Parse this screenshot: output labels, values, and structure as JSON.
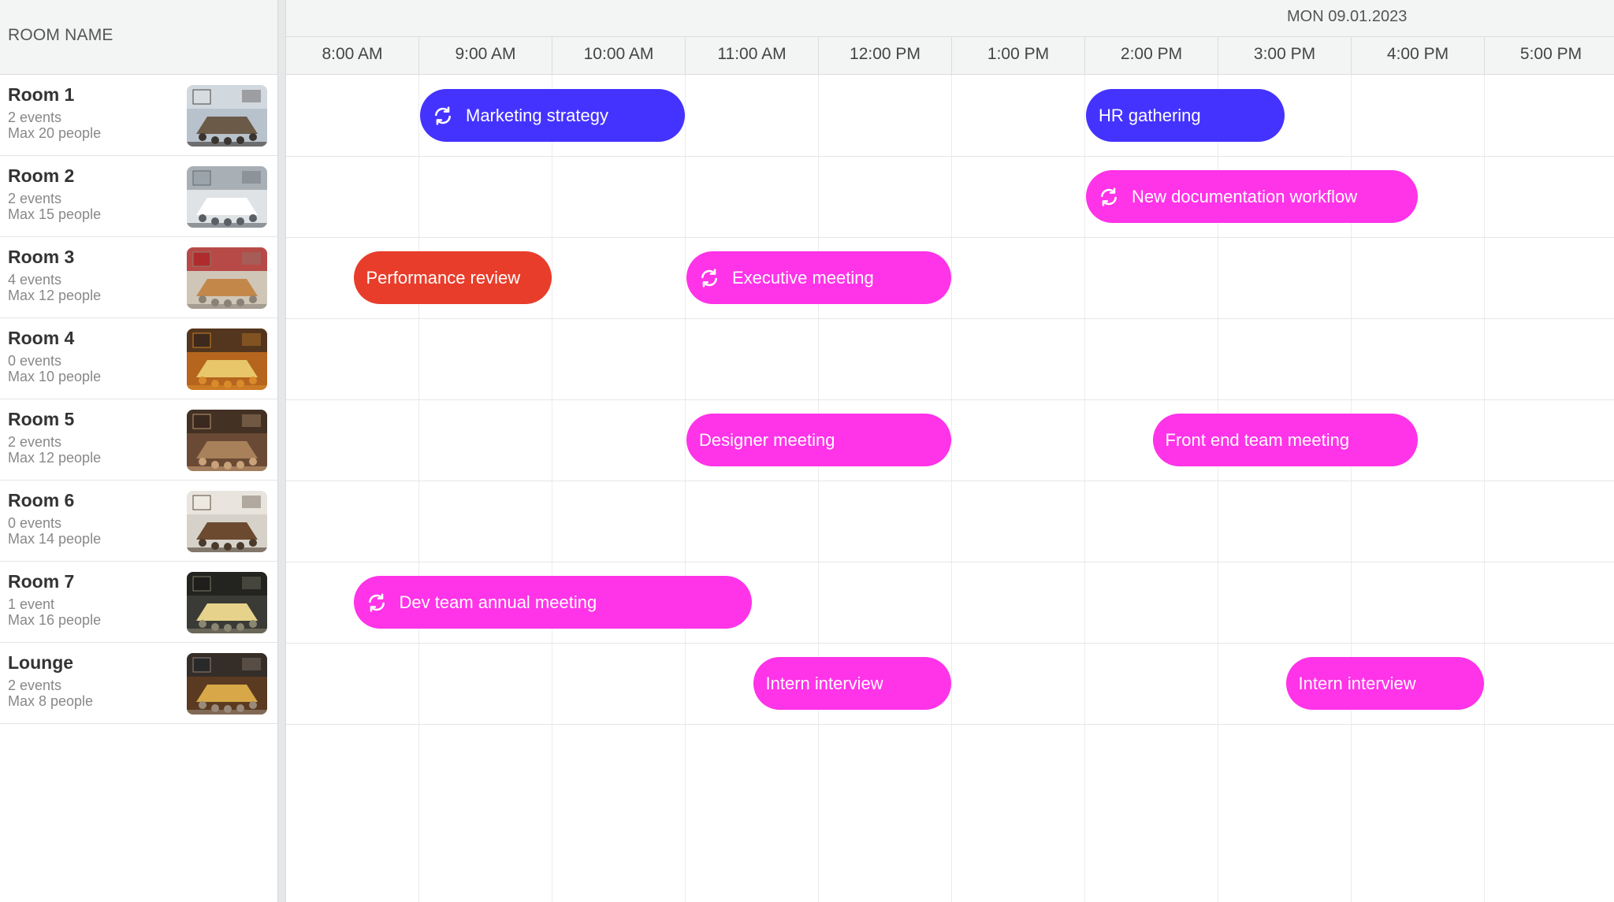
{
  "rooms_header": {
    "title": "ROOM NAME"
  },
  "timeline_header": {
    "date": "MON 09.01.2023",
    "hours": [
      "8:00 AM",
      "9:00 AM",
      "10:00 AM",
      "11:00 AM",
      "12:00 PM",
      "1:00 PM",
      "2:00 PM",
      "3:00 PM",
      "4:00 PM",
      "5:00 PM"
    ]
  },
  "colors": {
    "blue": "#4433ff",
    "magenta": "#ff33e8",
    "red": "#e83d2b"
  },
  "rooms": [
    {
      "name": "Room 1",
      "events": "2 events",
      "capacity": "Max 20 people",
      "photo": "conference-room-photo"
    },
    {
      "name": "Room 2",
      "events": "2 events",
      "capacity": "Max 15 people",
      "photo": "conference-room-photo"
    },
    {
      "name": "Room 3",
      "events": "4 events",
      "capacity": "Max 12 people",
      "photo": "conference-room-photo"
    },
    {
      "name": "Room 4",
      "events": "0 events",
      "capacity": "Max 10 people",
      "photo": "conference-room-photo"
    },
    {
      "name": "Room 5",
      "events": "2 events",
      "capacity": "Max 12 people",
      "photo": "conference-room-photo"
    },
    {
      "name": "Room 6",
      "events": "0 events",
      "capacity": "Max 14 people",
      "photo": "conference-room-photo"
    },
    {
      "name": "Room 7",
      "events": "1 event",
      "capacity": "Max 16 people",
      "photo": "conference-room-photo"
    },
    {
      "name": "Lounge",
      "events": "2 events",
      "capacity": "Max 8 people",
      "photo": "lounge-photo"
    }
  ],
  "events": [
    {
      "title": "Marketing strategy",
      "room": 0,
      "start": "9:00 AM",
      "end": "11:00 AM",
      "color": "blue",
      "recurring": true
    },
    {
      "title": "HR gathering",
      "room": 0,
      "start": "2:00 PM",
      "end": "3:30 PM",
      "color": "blue",
      "recurring": false
    },
    {
      "title": "New documentation workflow",
      "room": 1,
      "start": "2:00 PM",
      "end": "4:30 PM",
      "color": "magenta",
      "recurring": true
    },
    {
      "title": "Performance review",
      "room": 2,
      "start": "8:30 AM",
      "end": "10:00 AM",
      "color": "red",
      "recurring": false
    },
    {
      "title": "Executive meeting",
      "room": 2,
      "start": "11:00 AM",
      "end": "1:00 PM",
      "color": "magenta",
      "recurring": true
    },
    {
      "title": "Designer meeting",
      "room": 4,
      "start": "11:00 AM",
      "end": "1:00 PM",
      "color": "magenta",
      "recurring": false
    },
    {
      "title": "Front end team meeting",
      "room": 4,
      "start": "2:30 PM",
      "end": "4:30 PM",
      "color": "magenta",
      "recurring": false
    },
    {
      "title": "Dev team annual meeting",
      "room": 6,
      "start": "8:30 AM",
      "end": "11:30 AM",
      "color": "magenta",
      "recurring": true
    },
    {
      "title": "Intern interview",
      "room": 7,
      "start": "11:30 AM",
      "end": "1:00 PM",
      "color": "magenta",
      "recurring": false
    },
    {
      "title": "Intern interview",
      "room": 7,
      "start": "3:30 PM",
      "end": "5:00 PM",
      "color": "magenta",
      "recurring": false
    }
  ]
}
